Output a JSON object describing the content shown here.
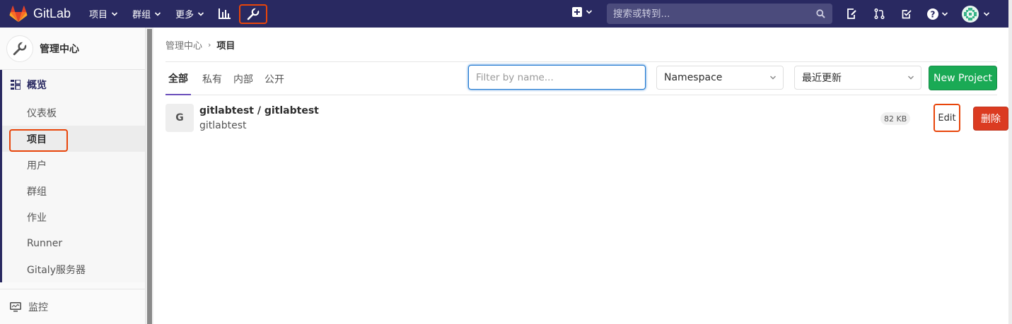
{
  "navbar": {
    "brand": "GitLab",
    "menu": [
      {
        "label": "项目"
      },
      {
        "label": "群组"
      },
      {
        "label": "更多"
      }
    ],
    "search_placeholder": "搜索或转到..."
  },
  "sidebar": {
    "context_title": "管理中心",
    "section_title": "概览",
    "items": [
      {
        "label": "仪表板"
      },
      {
        "label": "项目"
      },
      {
        "label": "用户"
      },
      {
        "label": "群组"
      },
      {
        "label": "作业"
      },
      {
        "label": "Runner"
      },
      {
        "label": "Gitaly服务器"
      }
    ],
    "monitoring": "监控"
  },
  "breadcrumb": {
    "root": "管理中心",
    "current": "项目"
  },
  "tabs": [
    {
      "label": "全部"
    },
    {
      "label": "私有"
    },
    {
      "label": "内部"
    },
    {
      "label": "公开"
    }
  ],
  "filter": {
    "placeholder": "Filter by name..."
  },
  "namespace_dropdown": {
    "value": "Namespace"
  },
  "sort_dropdown": {
    "value": "最近更新"
  },
  "new_project_label": "New Project",
  "projects": [
    {
      "avatar_letter": "G",
      "name": "gitlabtest / gitlabtest",
      "description": "gitlabtest",
      "size": "82 KB",
      "edit_label": "Edit",
      "delete_label": "删除"
    }
  ],
  "colors": {
    "navbar": "#292961",
    "highlight": "#e8450a",
    "primary_green": "#1aaa55",
    "danger": "#db3b21",
    "tab_underline": "#6b4fbb"
  }
}
